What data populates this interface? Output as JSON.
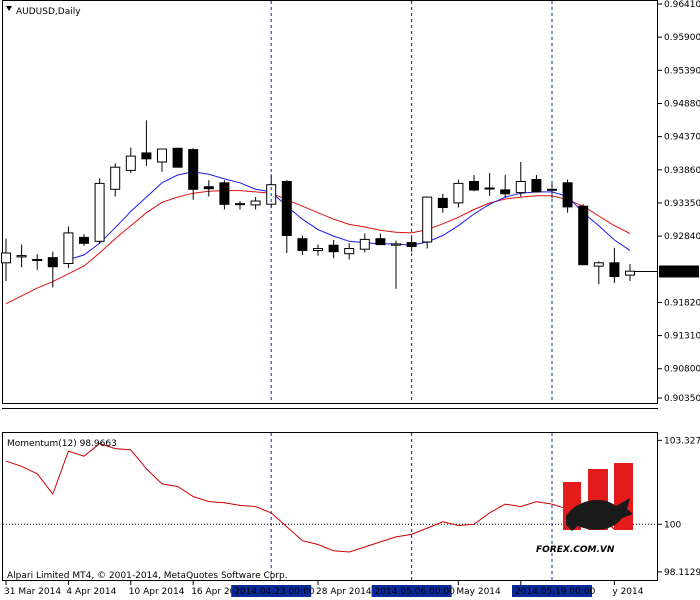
{
  "window": {
    "symbol_title": "AUDUSD,Daily",
    "copyright": "Alpari Limited MT4, © 2001-2014, MetaQuotes Software Corp.",
    "watermark_text": "FOREX.COM.VN"
  },
  "colors": {
    "background": "#ffffff",
    "frame": "#000000",
    "bull_candle_body": "#ffffff",
    "bear_candle_body": "#000000",
    "fast_ma": "#1a1aee",
    "slow_ma": "#dd1111",
    "momentum_line": "#cc0000",
    "current_price_box": "#000000",
    "crosshair_label_bg": "#0a2a9a",
    "crosshair_label_fg": "#ffffff",
    "logo_red": "#e41b1b"
  },
  "chart_data": [
    {
      "type": "candlestick",
      "title": "AUDUSD,Daily",
      "ylim": [
        0.9035,
        0.9641
      ],
      "y_ticks": [
        "0.96410",
        "0.95900",
        "0.95390",
        "0.94880",
        "0.94370",
        "0.93860",
        "0.93350",
        "0.92840",
        "0.92296",
        "0.91820",
        "0.91310",
        "0.90800",
        "0.90350"
      ],
      "current_price_label": "0.92296",
      "current_price": 0.92296,
      "ohlc": [
        {
          "o": 0.9243,
          "h": 0.928,
          "l": 0.9215,
          "c": 0.9258
        },
        {
          "o": 0.9252,
          "h": 0.9271,
          "l": 0.9236,
          "c": 0.9254
        },
        {
          "o": 0.9248,
          "h": 0.9256,
          "l": 0.9232,
          "c": 0.9248
        },
        {
          "o": 0.9251,
          "h": 0.926,
          "l": 0.9205,
          "c": 0.9237
        },
        {
          "o": 0.9242,
          "h": 0.9299,
          "l": 0.9235,
          "c": 0.9289
        },
        {
          "o": 0.9282,
          "h": 0.9287,
          "l": 0.9269,
          "c": 0.9273
        },
        {
          "o": 0.9276,
          "h": 0.9373,
          "l": 0.9272,
          "c": 0.9365
        },
        {
          "o": 0.9356,
          "h": 0.9396,
          "l": 0.9345,
          "c": 0.939
        },
        {
          "o": 0.9385,
          "h": 0.942,
          "l": 0.9381,
          "c": 0.9407
        },
        {
          "o": 0.9412,
          "h": 0.9462,
          "l": 0.9392,
          "c": 0.9403
        },
        {
          "o": 0.9398,
          "h": 0.9418,
          "l": 0.9383,
          "c": 0.9418
        },
        {
          "o": 0.9419,
          "h": 0.942,
          "l": 0.939,
          "c": 0.939
        },
        {
          "o": 0.9417,
          "h": 0.9419,
          "l": 0.934,
          "c": 0.9356
        },
        {
          "o": 0.936,
          "h": 0.937,
          "l": 0.9345,
          "c": 0.9357
        },
        {
          "o": 0.9366,
          "h": 0.937,
          "l": 0.9325,
          "c": 0.9333
        },
        {
          "o": 0.9334,
          "h": 0.9338,
          "l": 0.9325,
          "c": 0.9333
        },
        {
          "o": 0.9332,
          "h": 0.9344,
          "l": 0.9325,
          "c": 0.9338
        },
        {
          "o": 0.9333,
          "h": 0.9379,
          "l": 0.9327,
          "c": 0.9363
        },
        {
          "o": 0.9368,
          "h": 0.937,
          "l": 0.9258,
          "c": 0.9285
        },
        {
          "o": 0.928,
          "h": 0.9285,
          "l": 0.9255,
          "c": 0.9262
        },
        {
          "o": 0.9262,
          "h": 0.9271,
          "l": 0.9254,
          "c": 0.9265
        },
        {
          "o": 0.927,
          "h": 0.9278,
          "l": 0.925,
          "c": 0.926
        },
        {
          "o": 0.9257,
          "h": 0.9273,
          "l": 0.9248,
          "c": 0.9265
        },
        {
          "o": 0.9264,
          "h": 0.9288,
          "l": 0.9259,
          "c": 0.9279
        },
        {
          "o": 0.928,
          "h": 0.9288,
          "l": 0.9272,
          "c": 0.9271
        },
        {
          "o": 0.927,
          "h": 0.9277,
          "l": 0.9203,
          "c": 0.9272
        },
        {
          "o": 0.9274,
          "h": 0.9282,
          "l": 0.926,
          "c": 0.9268
        },
        {
          "o": 0.9275,
          "h": 0.9344,
          "l": 0.9265,
          "c": 0.9344
        },
        {
          "o": 0.9342,
          "h": 0.9349,
          "l": 0.932,
          "c": 0.9328
        },
        {
          "o": 0.9335,
          "h": 0.9371,
          "l": 0.9328,
          "c": 0.9365
        },
        {
          "o": 0.9368,
          "h": 0.9378,
          "l": 0.9353,
          "c": 0.9355
        },
        {
          "o": 0.9358,
          "h": 0.9381,
          "l": 0.9346,
          "c": 0.9358
        },
        {
          "o": 0.9355,
          "h": 0.9378,
          "l": 0.9343,
          "c": 0.9349
        },
        {
          "o": 0.9351,
          "h": 0.9398,
          "l": 0.9345,
          "c": 0.9368
        },
        {
          "o": 0.9371,
          "h": 0.9378,
          "l": 0.9351,
          "c": 0.9352
        },
        {
          "o": 0.9356,
          "h": 0.9365,
          "l": 0.9342,
          "c": 0.9356
        },
        {
          "o": 0.9366,
          "h": 0.9371,
          "l": 0.932,
          "c": 0.9329
        },
        {
          "o": 0.933,
          "h": 0.9333,
          "l": 0.924,
          "c": 0.924
        },
        {
          "o": 0.9238,
          "h": 0.9245,
          "l": 0.921,
          "c": 0.9243
        },
        {
          "o": 0.9243,
          "h": 0.9266,
          "l": 0.9212,
          "c": 0.9222
        },
        {
          "o": 0.9224,
          "h": 0.9241,
          "l": 0.9215,
          "c": 0.923
        }
      ],
      "ma_fast": [
        null,
        null,
        null,
        null,
        0.9248,
        0.9255,
        0.9273,
        0.9297,
        0.9322,
        0.9344,
        0.9366,
        0.9378,
        0.9383,
        0.9379,
        0.9372,
        0.9366,
        0.9356,
        0.9352,
        0.933,
        0.931,
        0.9294,
        0.9284,
        0.9276,
        0.9274,
        0.9272,
        0.9272,
        0.927,
        0.9275,
        0.9285,
        0.93,
        0.9318,
        0.9333,
        0.9344,
        0.935,
        0.9352,
        0.9352,
        0.9345,
        0.932,
        0.93,
        0.9278,
        0.9262
      ],
      "ma_slow": [
        0.918,
        0.9192,
        0.9204,
        0.9214,
        0.9226,
        0.9238,
        0.9258,
        0.928,
        0.93,
        0.932,
        0.9336,
        0.9344,
        0.935,
        0.9353,
        0.9354,
        0.9354,
        0.9352,
        0.935,
        0.934,
        0.933,
        0.932,
        0.931,
        0.9302,
        0.9298,
        0.9293,
        0.929,
        0.9289,
        0.9294,
        0.9303,
        0.9313,
        0.9325,
        0.9335,
        0.9341,
        0.9344,
        0.9346,
        0.9346,
        0.934,
        0.933,
        0.9315,
        0.93,
        0.9288
      ]
    },
    {
      "type": "line",
      "title": "Momentum(12) 98.9663",
      "ylim": [
        97.95,
        103.5
      ],
      "y_ticks": [
        "103.3277",
        "100",
        "98.1129"
      ],
      "level": 100,
      "values": [
        102.5,
        102.3,
        102.0,
        101.2,
        102.9,
        102.7,
        103.2,
        103.0,
        102.95,
        102.2,
        101.6,
        101.5,
        101.1,
        100.9,
        100.85,
        100.75,
        100.7,
        100.45,
        99.9,
        99.35,
        99.2,
        98.95,
        98.9,
        99.1,
        99.3,
        99.5,
        99.6,
        99.85,
        100.1,
        99.95,
        100.0,
        100.45,
        100.8,
        100.7,
        100.9,
        100.8,
        100.6,
        100.5,
        100.35,
        99.8,
        99.9
      ]
    }
  ],
  "x_axis": {
    "labels": [
      {
        "text": "31 Mar 2014",
        "i": 0
      },
      {
        "text": "4 Apr 2014",
        "i": 4
      },
      {
        "text": "10 Apr 2014",
        "i": 8
      },
      {
        "text": "16 Apr 20",
        "i": 12
      },
      {
        "text": "28 Apr 2014",
        "i": 20
      },
      {
        "text": "May 2014",
        "i": 29
      },
      {
        "text": "1",
        "i": 33
      },
      {
        "text": "y 2014",
        "i": 39
      }
    ],
    "crosshairs": [
      {
        "text": "2014.04.23 00:00",
        "i": 17
      },
      {
        "text": "2014.05.06 00:00",
        "i": 26
      },
      {
        "text": "2014.05.19 00:00",
        "i": 35
      }
    ]
  }
}
